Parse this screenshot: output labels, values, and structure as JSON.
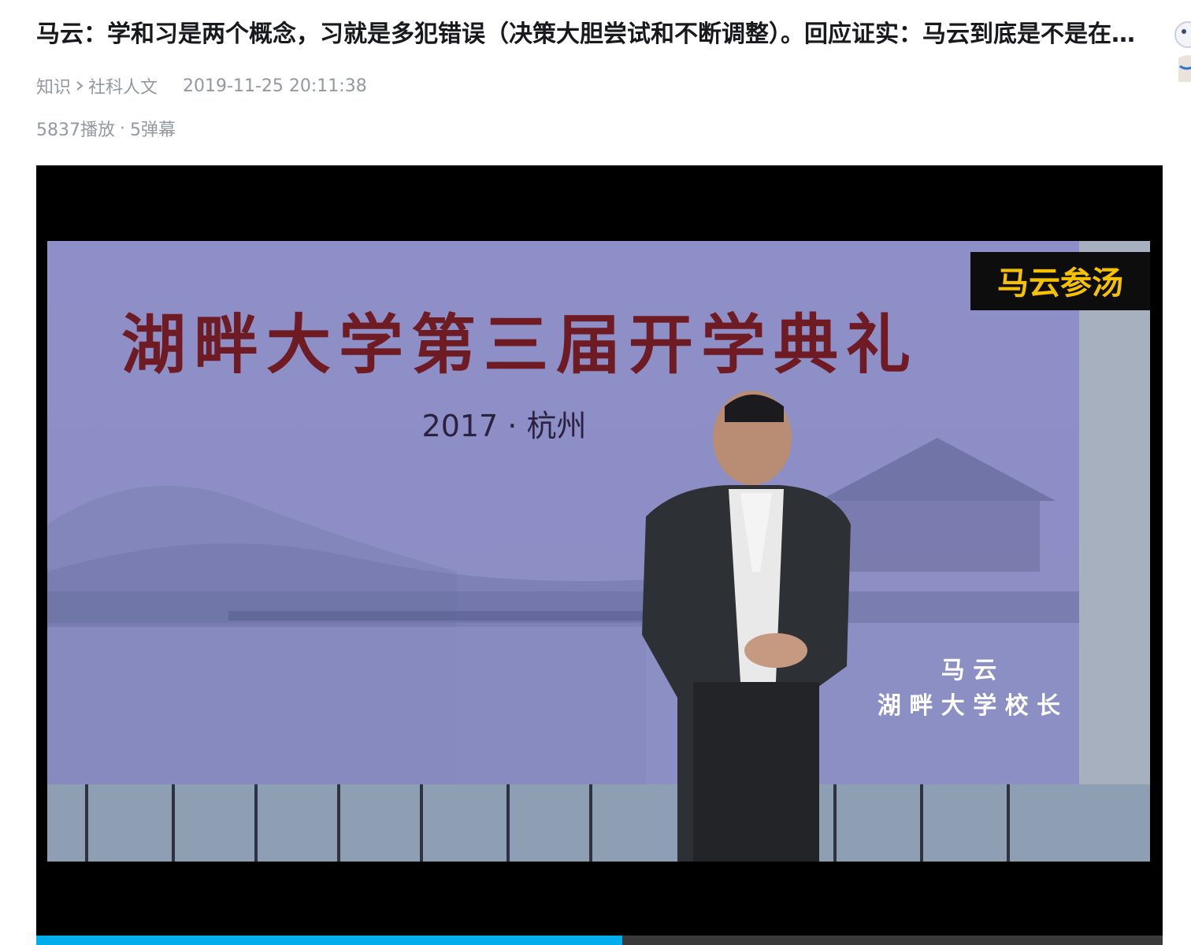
{
  "video": {
    "title": "马云：学和习是两个概念，习就是多犯错误（决策大胆尝试和不断调整）。回应证实：马云到底是不是在强调实践的重要性？",
    "category": "知识",
    "subcategory": "社科人文",
    "publish_time": "2019-11-25 20:11:38",
    "views": "5837播放",
    "danmaku": "5弹幕",
    "separator": "·"
  },
  "frame": {
    "banner_title": "湖畔大学第三届开学典礼",
    "banner_subtitle": "2017 · 杭州",
    "watermark": "马云参汤",
    "caption_name": "马 云",
    "caption_role": "湖 畔 大 学 校 长"
  },
  "player": {
    "progress_fraction": 0.52
  },
  "icons": {
    "breadcrumb_separator": "chevron-right-icon"
  },
  "colors": {
    "title": "#18191c",
    "meta": "#9499a0",
    "progress": "#00aeec",
    "banner_bg": "#8f8fc7",
    "banner_text": "#6e1b24",
    "watermark_text": "#f6c200"
  }
}
